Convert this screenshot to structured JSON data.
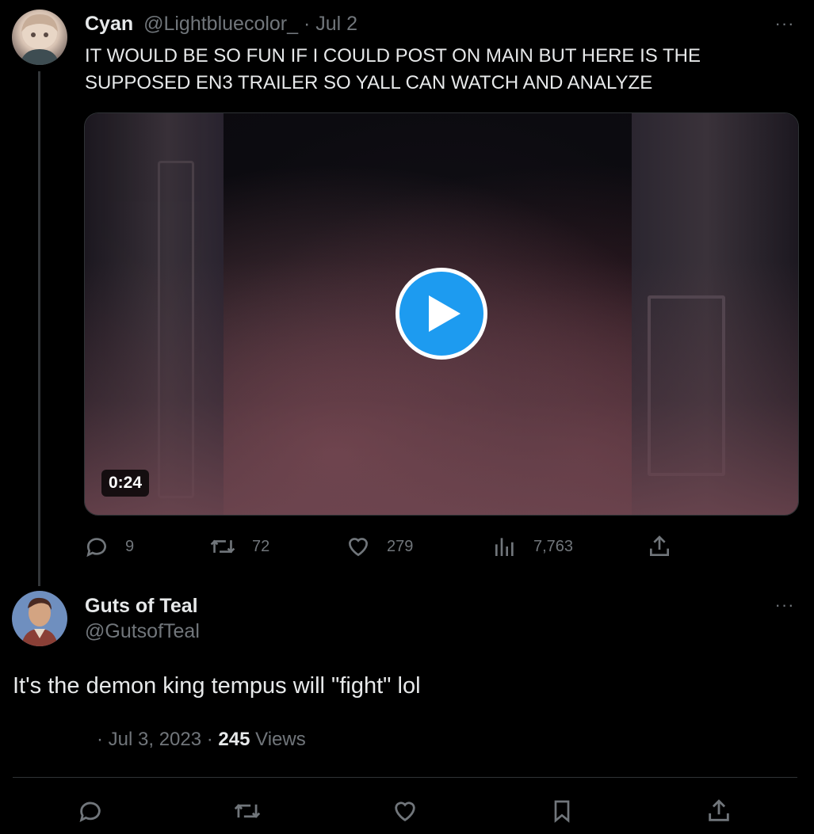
{
  "tweet1": {
    "name": "Cyan",
    "handle": "@Lightbluecolor_",
    "date": "· Jul 2",
    "text": "IT WOULD BE SO FUN IF I COULD POST ON MAIN BUT HERE IS THE SUPPOSED EN3 TRAILER SO YALL CAN WATCH AND ANALYZE",
    "video": {
      "duration": "0:24"
    },
    "stats": {
      "replies": "9",
      "retweets": "72",
      "likes": "279",
      "views": "7,763"
    }
  },
  "tweet2": {
    "name": "Guts of Teal",
    "handle": "@GutsofTeal",
    "text": "It's the demon king tempus will \"fight\" lol",
    "date": "· Jul 3, 2023 ·",
    "views_count": "245",
    "views_label": "Views"
  },
  "more_label": "···",
  "icons": {
    "reply": "reply-icon",
    "retweet": "retweet-icon",
    "like": "heart-icon",
    "views": "views-chart-icon",
    "share": "share-icon",
    "bookmark": "bookmark-icon",
    "play": "play-icon"
  },
  "colors": {
    "accent": "#1d9bf0",
    "muted": "#71767b",
    "text": "#e7e9ea",
    "background": "#000000"
  }
}
